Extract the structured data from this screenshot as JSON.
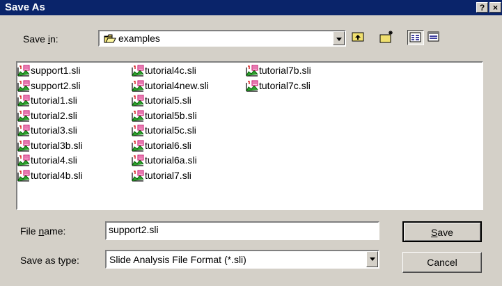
{
  "window": {
    "title": "Save As"
  },
  "titlebar": {
    "help": "?",
    "close": "×"
  },
  "save_in": {
    "label_pre": "Save ",
    "label_u": "i",
    "label_post": "n:",
    "value": "examples"
  },
  "toolbar": {
    "up_icon": "up-folder-icon",
    "new_folder_icon": "new-folder-icon",
    "list_icon": "list-view-icon",
    "details_icon": "details-view-icon"
  },
  "files": {
    "col1": [
      "support1.sli",
      "support2.sli",
      "tutorial1.sli",
      "tutorial2.sli",
      "tutorial3.sli",
      "tutorial3b.sli",
      "tutorial4.sli",
      "tutorial4b.sli"
    ],
    "col2": [
      "tutorial4c.sli",
      "tutorial4new.sli",
      "tutorial5.sli",
      "tutorial5b.sli",
      "tutorial5c.sli",
      "tutorial6.sli",
      "tutorial6a.sli",
      "tutorial7.sli"
    ],
    "col3": [
      "tutorial7b.sli",
      "tutorial7c.sli"
    ]
  },
  "filename": {
    "label_pre": "File ",
    "label_u": "n",
    "label_post": "ame:",
    "value": "support2.sli"
  },
  "filetype": {
    "label": "Save as type:",
    "value": "Slide Analysis File Format (*.sli)"
  },
  "buttons": {
    "save_u": "S",
    "save_rest": "ave",
    "cancel": "Cancel"
  },
  "colors": {
    "titlebar": "#0a246a",
    "face": "#d4d0c8"
  }
}
